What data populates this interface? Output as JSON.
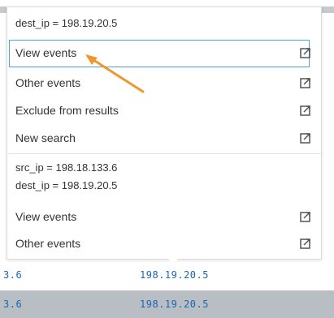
{
  "popup": {
    "section1": {
      "header": "dest_ip = 198.19.20.5",
      "items": [
        {
          "label": "View events"
        },
        {
          "label": "Other events"
        },
        {
          "label": "Exclude from results"
        },
        {
          "label": "New search"
        }
      ]
    },
    "section2": {
      "header_line1": "src_ip = 198.18.133.6",
      "header_line2": "dest_ip = 198.19.20.5",
      "items": [
        {
          "label": "View events"
        },
        {
          "label": "Other events"
        }
      ]
    },
    "external_icon": "external-link-icon"
  },
  "table": {
    "rows": [
      {
        "col1": "3.6",
        "col2": "198.19.20.5"
      },
      {
        "col1": "3.6",
        "col2": "198.19.20.5"
      }
    ]
  },
  "colors": {
    "focus_border": "#4aa3e6",
    "annotation_arrow": "#f0962e",
    "cell_text": "#1a66b3"
  }
}
